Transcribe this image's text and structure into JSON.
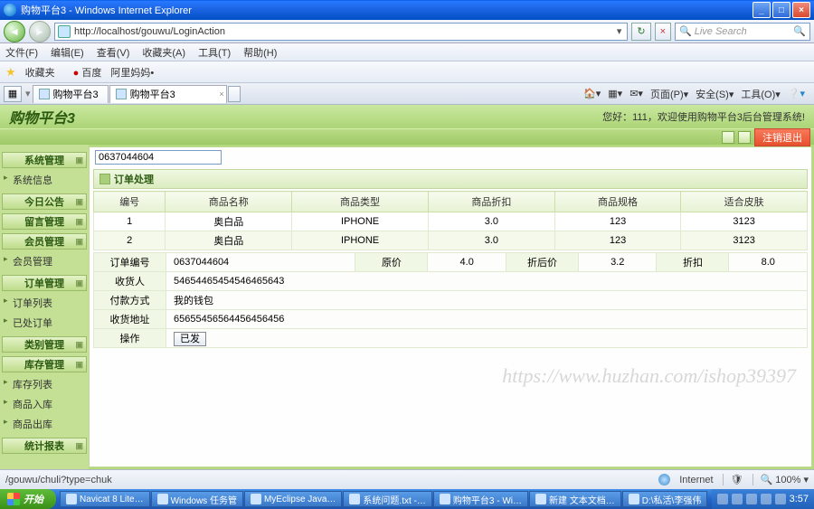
{
  "window": {
    "title": "购物平台3 - Windows Internet Explorer",
    "url": "http://localhost/gouwu/LoginAction",
    "search_placeholder": "Live Search"
  },
  "menus": [
    "文件(F)",
    "编辑(E)",
    "查看(V)",
    "收藏夹(A)",
    "工具(T)",
    "帮助(H)"
  ],
  "favbar": {
    "label": "收藏夹",
    "baidu": "百度",
    "suggest": "阿里妈妈•"
  },
  "tabs": [
    {
      "label": "购物平台3"
    },
    {
      "label": "购物平台3"
    }
  ],
  "tabtools": {
    "home": "",
    "page": "页面(P)",
    "safety": "安全(S)",
    "tools": "工具(O)",
    "help": ""
  },
  "banner": {
    "logo": "购物平台3",
    "welcome": "您好：111，欢迎使用购物平台3后台管理系统!",
    "logout": "注销退出"
  },
  "sidebar": {
    "groups": [
      {
        "title": "系统管理",
        "items": [
          "系统信息"
        ]
      },
      {
        "title": "今日公告",
        "items": []
      },
      {
        "title": "留言管理",
        "items": []
      },
      {
        "title": "会员管理",
        "items": [
          "会员管理"
        ]
      },
      {
        "title": "订单管理",
        "items": [
          "订单列表",
          "已处订单"
        ]
      },
      {
        "title": "类别管理",
        "items": []
      },
      {
        "title": "库存管理",
        "items": [
          "库存列表",
          "商品入库",
          "商品出库"
        ]
      },
      {
        "title": "统计报表",
        "items": []
      }
    ]
  },
  "orderid": "0637044604",
  "section_title": "订单处理",
  "grid": {
    "headers": [
      "编号",
      "商品名称",
      "商品类型",
      "商品折扣",
      "商品规格",
      "适合皮肤"
    ],
    "rows": [
      [
        "1",
        "奥白品",
        "IPHONE",
        "3.0",
        "123",
        "3123"
      ],
      [
        "2",
        "奥白品",
        "IPHONE",
        "3.0",
        "123",
        "3123"
      ]
    ]
  },
  "detail": {
    "r1": {
      "k1": "订单编号",
      "v1": "0637044604",
      "k2": "原价",
      "v2": "4.0",
      "k3": "折后价",
      "v3": "3.2",
      "k4": "折扣",
      "v4": "8.0"
    },
    "r2": {
      "k": "收货人",
      "v": "54654465454546465643"
    },
    "r3": {
      "k": "付款方式",
      "v": "我的钱包"
    },
    "r4": {
      "k": "收货地址",
      "v": "65655456564456456456"
    },
    "r5": {
      "k": "操作",
      "btn": "已发"
    }
  },
  "watermark": "https://www.huzhan.com/ishop39397",
  "statusbar": {
    "path": "/gouwu/chuli?type=chuk",
    "zone": "Internet",
    "zoom": "100%"
  },
  "taskbar": {
    "start": "开始",
    "tasks": [
      "Navicat 8 Lite…",
      "Windows 任务管",
      "MyEclipse Java…",
      "系统问题.txt -…",
      "购物平台3 - Wi…",
      "新建 文本文档…",
      "D:\\私活\\李强伟"
    ],
    "time": "3:57"
  }
}
